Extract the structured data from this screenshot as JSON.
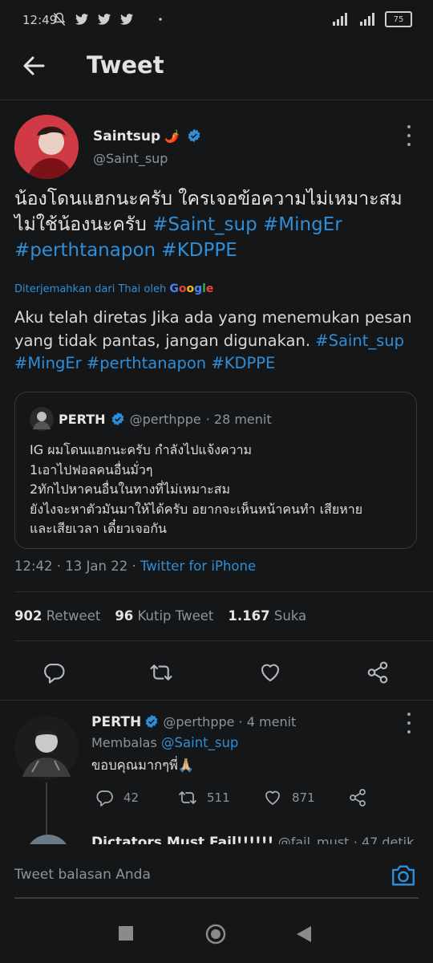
{
  "status_bar": {
    "time": "12:49",
    "battery": "75"
  },
  "header": {
    "title": "Tweet"
  },
  "tweet": {
    "author_name": "Saintsup",
    "author_emoji": "🌶️",
    "author_handle": "@Saint_sup",
    "text_plain": "น้องโดนแฮกนะครับ ใครเจอข้อความไม่เหมาะสมไม่ใช้น้องนะครับ ",
    "hashtags": [
      "#Saint_sup",
      "#MingEr",
      "#perthtanapon",
      "#KDPPE"
    ],
    "translated_label": "Diterjemahkan dari Thai oleh",
    "translated_brand": "Google",
    "translation_plain": "Aku telah diretas Jika ada yang menemukan pesan yang tidak pantas, jangan digunakan. ",
    "translation_hashtags": [
      "#Saint_sup",
      "#MingEr",
      "#perthtanapon",
      "#KDPPE"
    ],
    "quote": {
      "name": "PERTH",
      "handle": "@perthppe",
      "time": "· 28 menit",
      "text": "IG ผมโดนแฮกนะครับ กำลังไปแจ้งความ\n1เอาไปฟอลคนอื่นมั่วๆ\n2ทักไปหาคนอื่นในทางที่ไม่เหมาะสม\nยังไงจะหาตัวมันมาให้ได้ครับ อยากจะเห็นหน้าคนทำ เสียหาย\nและเสียเวลา เดี๋ยวเจอกัน"
    },
    "timestamp": "12:42 · 13 Jan 22 · ",
    "source": "Twitter for iPhone",
    "retweets_count": "902",
    "retweets_label": "Retweet",
    "quotes_count": "96",
    "quotes_label": "Kutip Tweet",
    "likes_count": "1.167",
    "likes_label": "Suka"
  },
  "reply": {
    "name": "PERTH",
    "handle": "@perthppe",
    "time": "· 4 menit",
    "replying_label": "Membalas",
    "replying_to": "@Saint_sup",
    "text": "ขอบคุณมากๆพี่🙏🏼",
    "reply_count": "42",
    "retweet_count": "511",
    "like_count": "871"
  },
  "next_reply_peek": {
    "name": "Dictators Must Fail!!!!!!",
    "handle": "@fail_must",
    "time": "· 47 detik"
  },
  "compose": {
    "placeholder": "Tweet balasan Anda"
  },
  "colors": {
    "background": "#151617",
    "link": "#2f8ed8",
    "verified": "#2f8ed8",
    "muted": "#8b949b"
  }
}
